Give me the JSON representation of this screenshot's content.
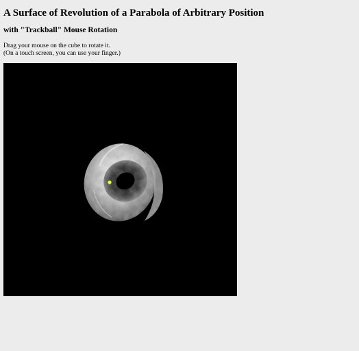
{
  "page": {
    "title": "A Surface of Revolution of a Parabola of Arbitrary Position",
    "subtitle": "with \"Trackball\" Mouse Rotation",
    "instruction_line1": "Drag your mouse on the cube to rotate it.",
    "instruction_line2": "(On a touch screen, you can use your finger.)"
  },
  "canvas": {
    "background": "#000000",
    "object": "textured-surface-of-revolution",
    "marker_color": "#e6ff2a"
  },
  "colors": {
    "page_background": "#ececec",
    "text": "#000000"
  }
}
